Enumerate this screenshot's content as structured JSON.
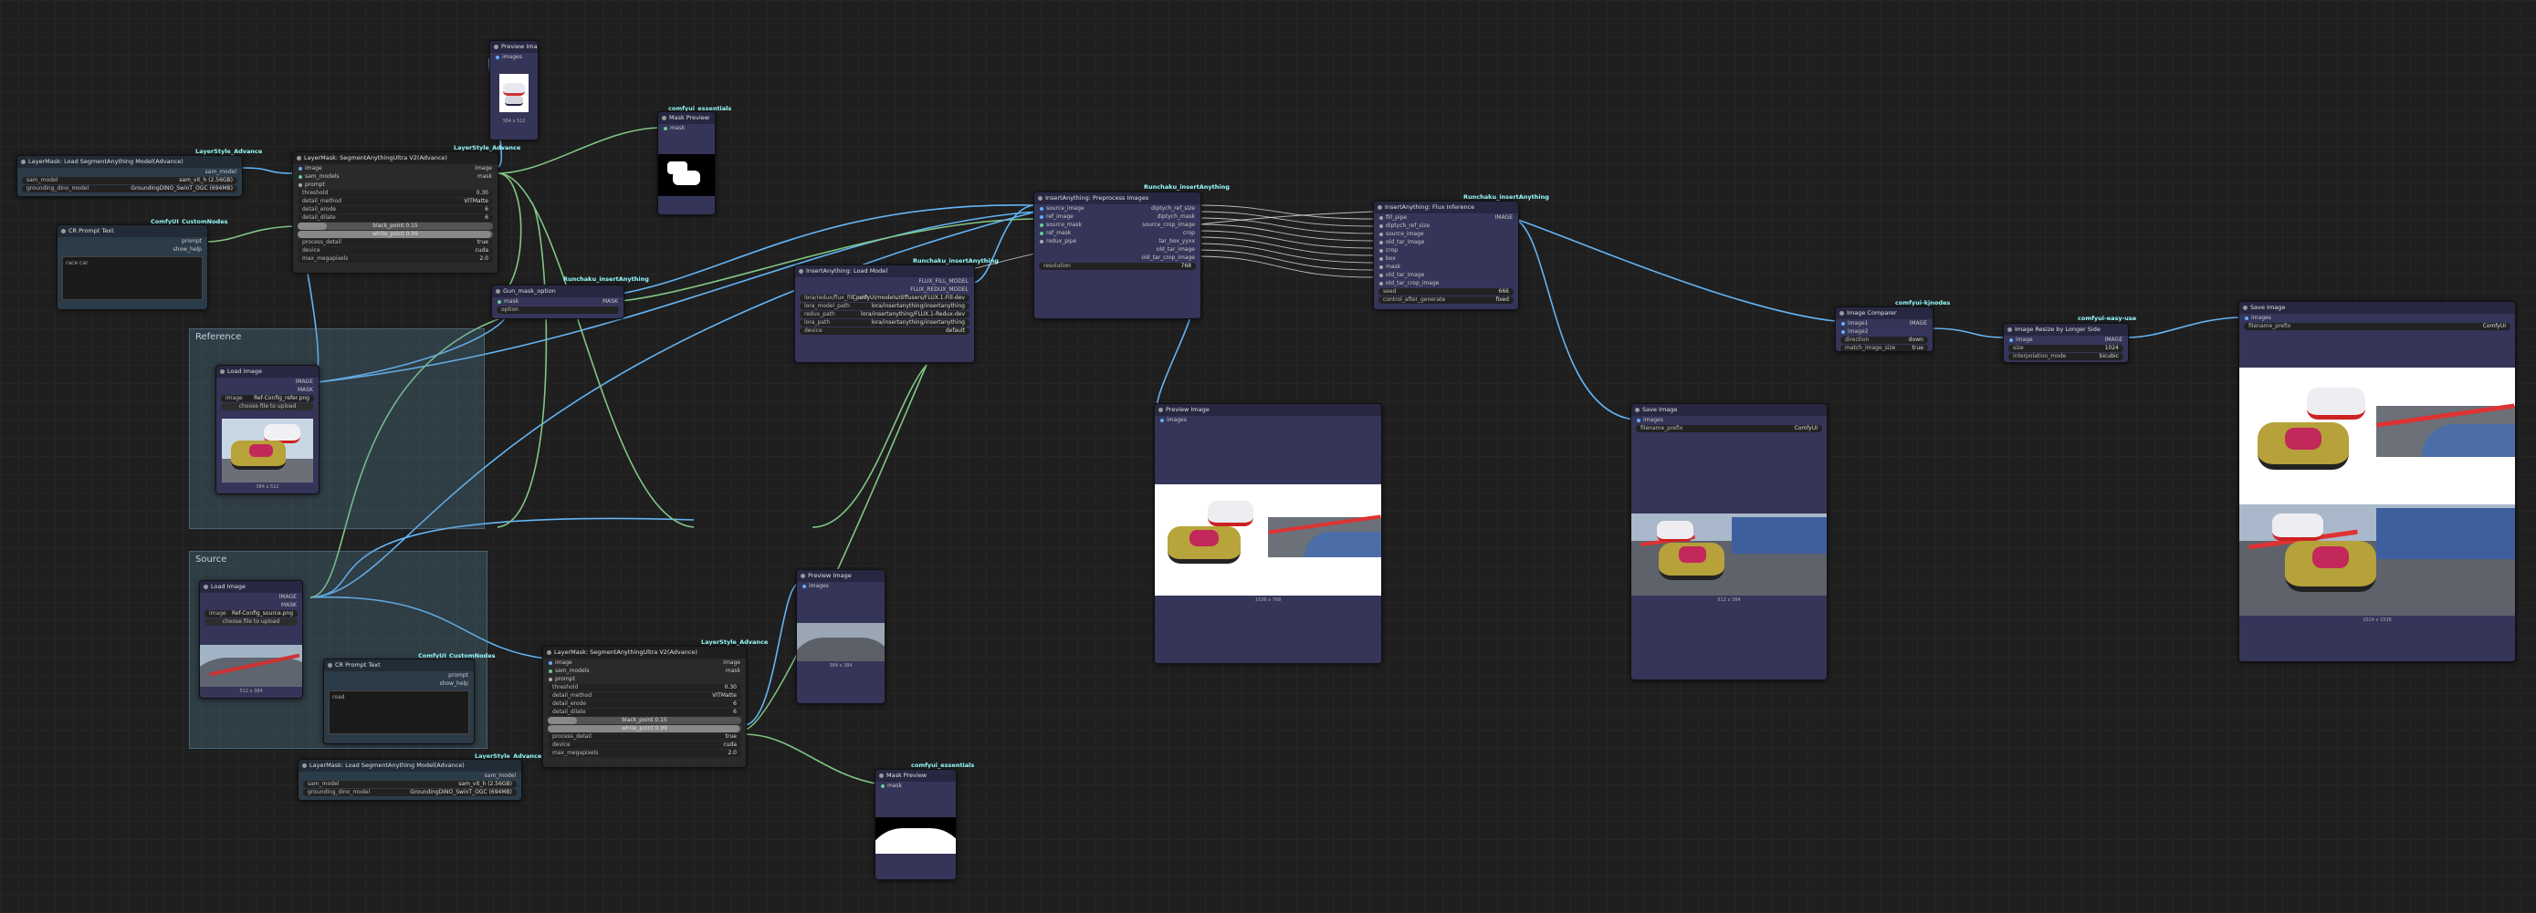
{
  "colors": {
    "canvas": "#1f1f1f",
    "node": "#353559",
    "wire_image": "#64b5f6",
    "wire_mask": "#81c784"
  },
  "groups": [
    {
      "title": "Reference"
    },
    {
      "title": "Source"
    }
  ],
  "nodes": {
    "load_segment_model_top": {
      "title": "LayerMask: Load SegmentAnything Model(Advance)",
      "badge": "LayerStyle_Advance",
      "output": "sam_model",
      "sam_model": "sam_vit_h (2.56GB)",
      "grounding_dino_model": "GroundingDINO_SwinT_OGC (694MB)"
    },
    "clip_text_top": {
      "title": "CR Prompt Text",
      "badge": "ComfyUI_CustomNodes",
      "out_prompt": "prompt",
      "out_show": "show_help",
      "text": "race car"
    },
    "segment_top": {
      "title": "LayerMask: SegmentAnythingUltra V2(Advance)",
      "badge": "LayerStyle_Advance",
      "inputs": [
        "image",
        "sam_models",
        "prompt"
      ],
      "outputs": [
        "image",
        "mask"
      ],
      "threshold": "0.30",
      "detail_method": "VITMatte",
      "detail_erode": "6",
      "detail_dilate": "6",
      "black_point": "black_point 0.15",
      "white_point": "white_point 0.99",
      "process_detail": "true",
      "device": "cuda",
      "max_megapixels": "2.0"
    },
    "preview_top": {
      "title": "Preview Image",
      "input": "images",
      "caption": "384 x 512"
    },
    "mask_preview_top": {
      "title": "Mask Preview",
      "badge": "comfyui_essentials",
      "input": "mask"
    },
    "gun_mask_top": {
      "title": "Gun_mask_option",
      "badge": "Runchaku_insertAnything",
      "inputs": [
        "mask"
      ],
      "output": "MASK",
      "option": "option"
    },
    "load_image_ref": {
      "title": "Load Image",
      "outputs": [
        "IMAGE",
        "MASK"
      ],
      "image": "Ref-Config_refer.png",
      "upload": "choose file to upload",
      "caption": "384 x 512"
    },
    "load_image_src": {
      "title": "Load Image",
      "outputs": [
        "IMAGE",
        "MASK"
      ],
      "image": "Ref-Config_source.png",
      "upload": "choose file to upload",
      "caption": "512 x 384"
    },
    "gun_mask_mid": {
      "title": "Gun_mask_option",
      "badge": "Runchaku_insertAnything",
      "inputs": [
        "mask",
        "option"
      ],
      "output": "MASK",
      "option": "option"
    },
    "load_insert": {
      "title": "InsertAnything: Load Model",
      "badge": "Runchaku_insertAnything",
      "inputs": [],
      "flux_fill": "FLUX_FILL_MODEL",
      "flux_redux": "FLUX_REDUX_MODEL",
      "w1_label": "lora/redux/flux_fill_path",
      "w1": "ComfyUI/models/diffusers/FLUX.1-Fill-dev",
      "w2_label": "lora_model_path",
      "w2": "lora/insertanything/insertanything",
      "w3_label": "redux_path",
      "w3": "lora/insertanything/FLUX.1-Redux-dev",
      "w4_label": "lora_path",
      "w4": "lora/insertanything/insertanything",
      "w5_label": "device",
      "w5": "default"
    },
    "insert_preprocess": {
      "title": "InsertAnything: Preprocess Images",
      "badge": "Runchaku_insertAnything",
      "inputs": [
        "source_image",
        "ref_image",
        "source_mask",
        "ref_mask",
        "redux_pipe"
      ],
      "outputs": [
        "diptych_ref_size",
        "diptych_mask",
        "source_crop_image",
        "crop",
        "tar_box_yyxx",
        "old_tar_image",
        "old_tar_crop_image"
      ],
      "resolution": "resolution",
      "resolution_val": "768"
    },
    "insert_flux": {
      "title": "InsertAnything: Flux Inference",
      "badge": "Runchaku_insertAnything",
      "inputs": [
        "fill_pipe",
        "diptych_ref_size",
        "source_image",
        "old_tar_image",
        "crop",
        "box",
        "mask",
        "old_tar_image",
        "old_tar_crop_image"
      ],
      "output": "IMAGE",
      "seed": "seed",
      "seed_val": "666",
      "after": "control_after_generate",
      "after_val": "fixed"
    },
    "preview_mid": {
      "title": "Preview Image",
      "input": "images",
      "caption": "1536 x 768"
    },
    "save_mid": {
      "title": "Save Image",
      "input": "images",
      "prefix_label": "filename_prefix",
      "prefix": "ComfyUI",
      "caption": "512 x 384"
    },
    "image_comparer": {
      "title": "Image Comparer",
      "badge": "comfyui-kjnodes",
      "inputs": [
        "image1",
        "image2"
      ],
      "output": "IMAGE",
      "dir_label": "direction",
      "dir": "down",
      "match_label": "match_image_size",
      "match": "true"
    },
    "image_resize": {
      "title": "Image Resize by Longer Side",
      "badge": "comfyui-easy-use",
      "inputs": [
        "image"
      ],
      "output": "IMAGE",
      "size_label": "size",
      "size": "1024",
      "interp_label": "interpolation_mode",
      "interp": "bicubic"
    },
    "save_right": {
      "title": "Save Image",
      "input": "images",
      "prefix_label": "filename_prefix",
      "prefix": "ComfyUI",
      "caption": "1024 x 1536"
    },
    "preview_bottom": {
      "title": "Preview Image",
      "input": "images",
      "caption": "384 x 384"
    },
    "clip_text_bottom": {
      "title": "CR Prompt Text",
      "badge": "ComfyUI_CustomNodes",
      "out_prompt": "prompt",
      "out_show": "show_help",
      "text": "road"
    },
    "segment_bottom": {
      "title": "LayerMask: SegmentAnythingUltra V2(Advance)",
      "badge": "LayerStyle_Advance",
      "inputs": [
        "image",
        "sam_models",
        "prompt"
      ],
      "outputs": [
        "image",
        "mask"
      ],
      "threshold": "0.30",
      "detail_method": "VITMatte",
      "detail_erode": "6",
      "detail_dilate": "6",
      "black_point": "black_point 0.15",
      "white_point": "white_point 0.99",
      "process_detail": "true",
      "device": "cuda",
      "max_megapixels": "2.0"
    },
    "load_segment_model_bottom": {
      "title": "LayerMask: Load SegmentAnything Model(Advance)",
      "badge": "LayerStyle_Advance",
      "output": "sam_model",
      "sam_model": "sam_vit_h (2.56GB)",
      "grounding_dino_model": "GroundingDINO_SwinT_OGC (694MB)"
    },
    "mask_preview_bottom": {
      "title": "Mask Preview",
      "badge": "comfyui_essentials",
      "input": "mask"
    }
  },
  "labels": {
    "threshold": "threshold",
    "detail_method": "detail_method",
    "detail_erode": "detail_erode",
    "detail_dilate": "detail_dilate",
    "process_detail": "process_detail",
    "device": "device",
    "max_megapixels": "max_megapixels",
    "sam_model": "sam_model",
    "grounding_dino_model": "grounding_dino_model",
    "image": "image"
  }
}
